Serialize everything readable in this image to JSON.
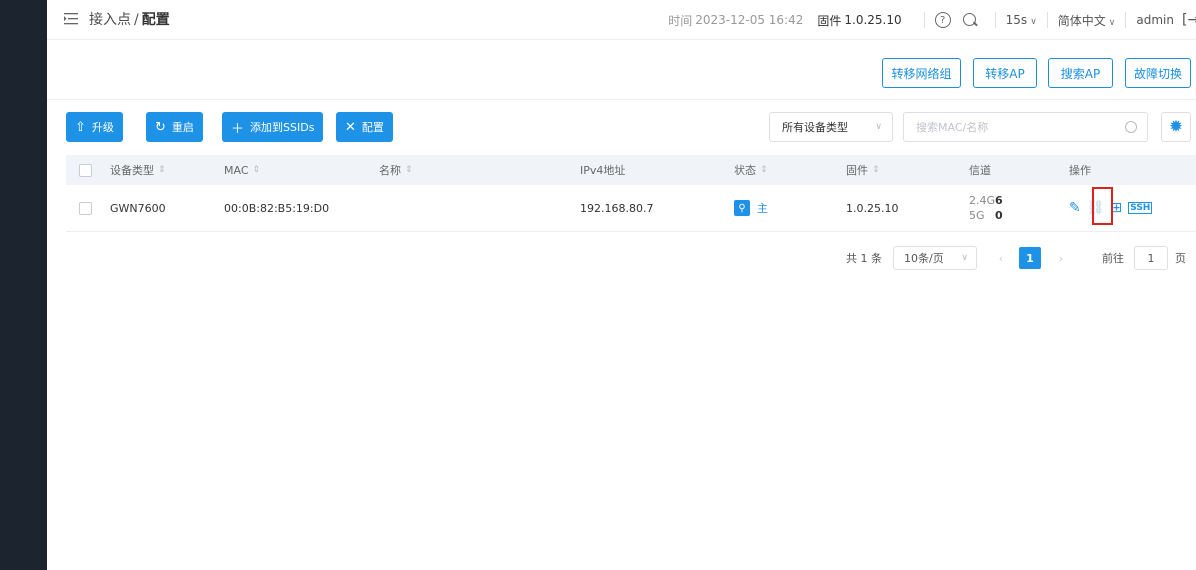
{
  "breadcrumb": {
    "parent": "接入点",
    "separator": "/",
    "current": "配置"
  },
  "topbar": {
    "time_label": "时间",
    "time_value": "2023-12-05 16:42",
    "firmware_label": "固件",
    "firmware_value": "1.0.25.10",
    "refresh_interval": "15s",
    "language": "简体中文",
    "user": "admin"
  },
  "action_buttons": [
    "转移网络组",
    "转移AP",
    "搜索AP",
    "故障切换"
  ],
  "toolbar": {
    "upgrade": "升级",
    "reboot": "重启",
    "add_to_ssids": "添加到SSIDs",
    "configure": "配置",
    "device_type_filter": "所有设备类型",
    "search_placeholder": "搜索MAC/名称"
  },
  "table": {
    "headers": {
      "device_type": "设备类型",
      "mac": "MAC",
      "name": "名称",
      "ipv4": "IPv4地址",
      "status": "状态",
      "firmware": "固件",
      "channel": "信道",
      "actions": "操作"
    },
    "rows": [
      {
        "device_type": "GWN7600",
        "mac": "00:0B:82:B5:19:D0",
        "name": "",
        "ipv4": "192.168.80.7",
        "status": "主",
        "firmware": "1.0.25.10",
        "channel_24_label": "2.4G",
        "channel_24_value": "6",
        "channel_5_label": "5G",
        "channel_5_value": "0"
      }
    ]
  },
  "pagination": {
    "total": "共 1 条",
    "page_size": "10条/页",
    "current_page": "1",
    "goto_label": "前往",
    "goto_value": "1",
    "goto_suffix": "页"
  },
  "icons": {
    "sidebar": [
      "logo-icon",
      "chart-icon",
      "access-point-icon",
      "wifi-icon",
      "clients-icon",
      "settings-sliders-icon",
      "list-icon",
      "guest-wifi-icon",
      "shield-icon",
      "menu-icon",
      "gear-icon"
    ],
    "row_actions": [
      "edit-icon",
      "unpair-link-icon",
      "locate-icon",
      "ssh-icon"
    ]
  },
  "colors": {
    "accent": "#1e92e6",
    "sidebar": "#1c2430",
    "highlight_box": "#e0201b"
  }
}
